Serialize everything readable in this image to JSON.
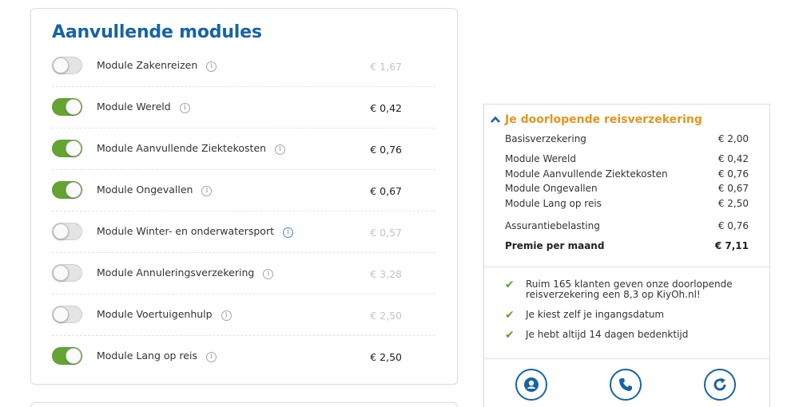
{
  "modules_card": {
    "title": "Aanvullende modules",
    "items": [
      {
        "label": "Module Zakenreizen",
        "price": "€ 1,67",
        "enabled": false
      },
      {
        "label": "Module Wereld",
        "price": "€ 0,42",
        "enabled": true
      },
      {
        "label": "Module Aanvullende Ziektekosten",
        "price": "€ 0,76",
        "enabled": true
      },
      {
        "label": "Module Ongevallen",
        "price": "€ 0,67",
        "enabled": true
      },
      {
        "label": "Module Winter- en onderwatersport",
        "price": "€ 0,57",
        "enabled": false
      },
      {
        "label": "Module Annuleringsverzekering",
        "price": "€ 3,28",
        "enabled": false
      },
      {
        "label": "Module Voertuigenhulp",
        "price": "€ 2,50",
        "enabled": false
      },
      {
        "label": "Module Lang op reis",
        "price": "€ 2,50",
        "enabled": true
      }
    ],
    "info_glyph": "i"
  },
  "summary": {
    "title": "Je doorlopende reisverzekering",
    "chevron": "^",
    "base": {
      "label": "Basisverzekering",
      "value": "€ 2,00"
    },
    "modules": [
      {
        "label": "Module Wereld",
        "value": "€ 0,42"
      },
      {
        "label": "Module Aanvullende Ziektekosten",
        "value": "€ 0,76"
      },
      {
        "label": "Module Ongevallen",
        "value": "€ 0,67"
      },
      {
        "label": "Module Lang op reis",
        "value": "€ 2,50"
      }
    ],
    "tax": {
      "label": "Assurantiebelasting",
      "value": "€ 0,76"
    },
    "total": {
      "label": "Premie per maand",
      "value": "€ 7,11"
    }
  },
  "usps": [
    "Ruim 165 klanten geven onze doorlopende reisverzekering een 8,3 op KiyOh.nl!",
    "Je kiest zelf je ingangsdatum",
    "Je hebt altijd 14 dagen bedenktijd"
  ],
  "action_icons": [
    "chat-icon",
    "phone-icon",
    "refresh-icon"
  ],
  "colors": {
    "brand_blue": "#1763a6",
    "accent_orange": "#e8941a",
    "toggle_green": "#64a532"
  }
}
